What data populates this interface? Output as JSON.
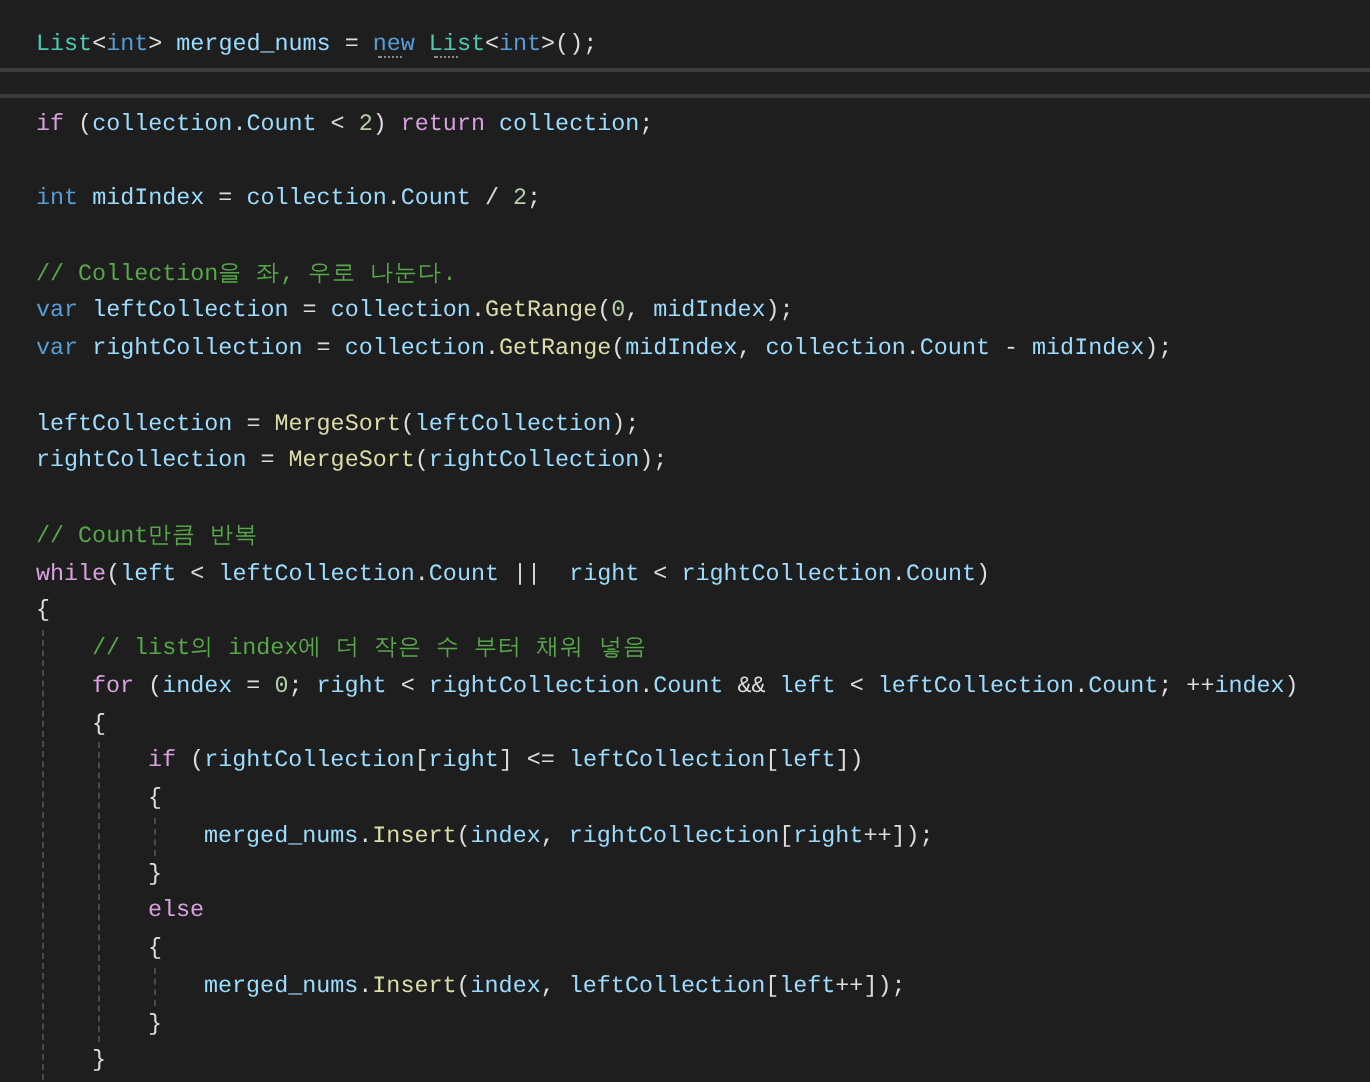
{
  "editor": {
    "lines": [
      {
        "kind": "code",
        "tokens": [
          {
            "kind": "type",
            "text": "List"
          },
          {
            "kind": "punct",
            "text": "<"
          },
          {
            "kind": "kw",
            "text": "int"
          },
          {
            "kind": "punct",
            "text": "> "
          },
          {
            "kind": "var",
            "text": "merged_nums"
          },
          {
            "kind": "punct",
            "text": " = "
          },
          {
            "kind": "kw",
            "text": "new ",
            "hint": true
          },
          {
            "kind": "type",
            "text": "List",
            "hint": true
          },
          {
            "kind": "punct",
            "text": "<"
          },
          {
            "kind": "kw",
            "text": "int"
          },
          {
            "kind": "punct",
            "text": ">();"
          }
        ]
      },
      {
        "kind": "cursor-line"
      },
      {
        "kind": "code",
        "tokens": [
          {
            "kind": "ctrl",
            "text": "if"
          },
          {
            "kind": "punct",
            "text": " ("
          },
          {
            "kind": "var",
            "text": "collection"
          },
          {
            "kind": "punct",
            "text": "."
          },
          {
            "kind": "var",
            "text": "Count"
          },
          {
            "kind": "punct",
            "text": " < "
          },
          {
            "kind": "num",
            "text": "2"
          },
          {
            "kind": "punct",
            "text": ") "
          },
          {
            "kind": "ctrl",
            "text": "return "
          },
          {
            "kind": "var",
            "text": "collection"
          },
          {
            "kind": "punct",
            "text": ";"
          }
        ]
      },
      {
        "kind": "blank"
      },
      {
        "kind": "code",
        "tokens": [
          {
            "kind": "kw",
            "text": "int "
          },
          {
            "kind": "var",
            "text": "midIndex"
          },
          {
            "kind": "punct",
            "text": " = "
          },
          {
            "kind": "var",
            "text": "collection"
          },
          {
            "kind": "punct",
            "text": "."
          },
          {
            "kind": "var",
            "text": "Count"
          },
          {
            "kind": "punct",
            "text": " / "
          },
          {
            "kind": "num",
            "text": "2"
          },
          {
            "kind": "punct",
            "text": ";"
          }
        ]
      },
      {
        "kind": "blank"
      },
      {
        "kind": "code",
        "tokens": [
          {
            "kind": "cmt",
            "text": "// Collection을 좌, 우로 나눈다."
          }
        ]
      },
      {
        "kind": "code",
        "tokens": [
          {
            "kind": "kw",
            "text": "var "
          },
          {
            "kind": "var",
            "text": "leftCollection"
          },
          {
            "kind": "punct",
            "text": " = "
          },
          {
            "kind": "var",
            "text": "collection"
          },
          {
            "kind": "punct",
            "text": "."
          },
          {
            "kind": "fn",
            "text": "GetRange"
          },
          {
            "kind": "punct",
            "text": "("
          },
          {
            "kind": "num",
            "text": "0"
          },
          {
            "kind": "punct",
            "text": ", "
          },
          {
            "kind": "var",
            "text": "midIndex"
          },
          {
            "kind": "punct",
            "text": ");"
          }
        ]
      },
      {
        "kind": "code",
        "tokens": [
          {
            "kind": "kw",
            "text": "var "
          },
          {
            "kind": "var",
            "text": "rightCollection"
          },
          {
            "kind": "punct",
            "text": " = "
          },
          {
            "kind": "var",
            "text": "collection"
          },
          {
            "kind": "punct",
            "text": "."
          },
          {
            "kind": "fn",
            "text": "GetRange"
          },
          {
            "kind": "punct",
            "text": "("
          },
          {
            "kind": "var",
            "text": "midIndex"
          },
          {
            "kind": "punct",
            "text": ", "
          },
          {
            "kind": "var",
            "text": "collection"
          },
          {
            "kind": "punct",
            "text": "."
          },
          {
            "kind": "var",
            "text": "Count"
          },
          {
            "kind": "punct",
            "text": " - "
          },
          {
            "kind": "var",
            "text": "midIndex"
          },
          {
            "kind": "punct",
            "text": ");"
          }
        ]
      },
      {
        "kind": "blank"
      },
      {
        "kind": "code",
        "tokens": [
          {
            "kind": "var",
            "text": "leftCollection"
          },
          {
            "kind": "punct",
            "text": " = "
          },
          {
            "kind": "fn",
            "text": "MergeSort"
          },
          {
            "kind": "punct",
            "text": "("
          },
          {
            "kind": "var",
            "text": "leftCollection"
          },
          {
            "kind": "punct",
            "text": ");"
          }
        ]
      },
      {
        "kind": "code",
        "tokens": [
          {
            "kind": "var",
            "text": "rightCollection"
          },
          {
            "kind": "punct",
            "text": " = "
          },
          {
            "kind": "fn",
            "text": "MergeSort"
          },
          {
            "kind": "punct",
            "text": "("
          },
          {
            "kind": "var",
            "text": "rightCollection"
          },
          {
            "kind": "punct",
            "text": ");"
          }
        ]
      },
      {
        "kind": "blank"
      },
      {
        "kind": "code",
        "tokens": [
          {
            "kind": "cmt",
            "text": "// Count만큼 반복"
          }
        ]
      },
      {
        "kind": "code",
        "tokens": [
          {
            "kind": "ctrl",
            "text": "while"
          },
          {
            "kind": "punct",
            "text": "("
          },
          {
            "kind": "var",
            "text": "left"
          },
          {
            "kind": "punct",
            "text": " < "
          },
          {
            "kind": "var",
            "text": "leftCollection"
          },
          {
            "kind": "punct",
            "text": "."
          },
          {
            "kind": "var",
            "text": "Count"
          },
          {
            "kind": "punct",
            "text": " ||  "
          },
          {
            "kind": "var",
            "text": "right"
          },
          {
            "kind": "punct",
            "text": " < "
          },
          {
            "kind": "var",
            "text": "rightCollection"
          },
          {
            "kind": "punct",
            "text": "."
          },
          {
            "kind": "var",
            "text": "Count"
          },
          {
            "kind": "punct",
            "text": ")"
          }
        ]
      },
      {
        "kind": "code",
        "tokens": [
          {
            "kind": "punct",
            "text": "{"
          }
        ],
        "children": [
          {
            "kind": "code",
            "tokens": [
              {
                "kind": "cmt",
                "text": "// list의 index에 더 작은 수 부터 채워 넣음"
              }
            ]
          },
          {
            "kind": "code",
            "tokens": [
              {
                "kind": "ctrl",
                "text": "for"
              },
              {
                "kind": "punct",
                "text": " ("
              },
              {
                "kind": "var",
                "text": "index"
              },
              {
                "kind": "punct",
                "text": " = "
              },
              {
                "kind": "num",
                "text": "0"
              },
              {
                "kind": "punct",
                "text": "; "
              },
              {
                "kind": "var",
                "text": "right"
              },
              {
                "kind": "punct",
                "text": " < "
              },
              {
                "kind": "var",
                "text": "rightCollection"
              },
              {
                "kind": "punct",
                "text": "."
              },
              {
                "kind": "var",
                "text": "Count"
              },
              {
                "kind": "punct",
                "text": " && "
              },
              {
                "kind": "var",
                "text": "left"
              },
              {
                "kind": "punct",
                "text": " < "
              },
              {
                "kind": "var",
                "text": "leftCollection"
              },
              {
                "kind": "punct",
                "text": "."
              },
              {
                "kind": "var",
                "text": "Count"
              },
              {
                "kind": "punct",
                "text": "; ++"
              },
              {
                "kind": "var",
                "text": "index"
              },
              {
                "kind": "punct",
                "text": ")"
              }
            ]
          },
          {
            "kind": "code",
            "tokens": [
              {
                "kind": "punct",
                "text": "{"
              }
            ],
            "children": [
              {
                "kind": "code",
                "tokens": [
                  {
                    "kind": "ctrl",
                    "text": "if"
                  },
                  {
                    "kind": "punct",
                    "text": " ("
                  },
                  {
                    "kind": "var",
                    "text": "rightCollection"
                  },
                  {
                    "kind": "punct",
                    "text": "["
                  },
                  {
                    "kind": "var",
                    "text": "right"
                  },
                  {
                    "kind": "punct",
                    "text": "] <= "
                  },
                  {
                    "kind": "var",
                    "text": "leftCollection"
                  },
                  {
                    "kind": "punct",
                    "text": "["
                  },
                  {
                    "kind": "var",
                    "text": "left"
                  },
                  {
                    "kind": "punct",
                    "text": "])"
                  }
                ]
              },
              {
                "kind": "code",
                "tokens": [
                  {
                    "kind": "punct",
                    "text": "{"
                  }
                ],
                "children": [
                  {
                    "kind": "code",
                    "tokens": [
                      {
                        "kind": "var",
                        "text": "merged_nums"
                      },
                      {
                        "kind": "punct",
                        "text": "."
                      },
                      {
                        "kind": "fn",
                        "text": "Insert"
                      },
                      {
                        "kind": "punct",
                        "text": "("
                      },
                      {
                        "kind": "var",
                        "text": "index"
                      },
                      {
                        "kind": "punct",
                        "text": ", "
                      },
                      {
                        "kind": "var",
                        "text": "rightCollection"
                      },
                      {
                        "kind": "punct",
                        "text": "["
                      },
                      {
                        "kind": "var",
                        "text": "right"
                      },
                      {
                        "kind": "punct",
                        "text": "++]);"
                      }
                    ]
                  }
                ]
              },
              {
                "kind": "code",
                "tokens": [
                  {
                    "kind": "punct",
                    "text": "}"
                  }
                ]
              },
              {
                "kind": "code",
                "tokens": [
                  {
                    "kind": "ctrl",
                    "text": "else"
                  }
                ]
              },
              {
                "kind": "code",
                "tokens": [
                  {
                    "kind": "punct",
                    "text": "{"
                  }
                ],
                "children": [
                  {
                    "kind": "code",
                    "tokens": [
                      {
                        "kind": "var",
                        "text": "merged_nums"
                      },
                      {
                        "kind": "punct",
                        "text": "."
                      },
                      {
                        "kind": "fn",
                        "text": "Insert"
                      },
                      {
                        "kind": "punct",
                        "text": "("
                      },
                      {
                        "kind": "var",
                        "text": "index"
                      },
                      {
                        "kind": "punct",
                        "text": ", "
                      },
                      {
                        "kind": "var",
                        "text": "leftCollection"
                      },
                      {
                        "kind": "punct",
                        "text": "["
                      },
                      {
                        "kind": "var",
                        "text": "left"
                      },
                      {
                        "kind": "punct",
                        "text": "++]);"
                      }
                    ]
                  }
                ]
              },
              {
                "kind": "code",
                "tokens": [
                  {
                    "kind": "punct",
                    "text": "}"
                  }
                ]
              }
            ]
          },
          {
            "kind": "code",
            "tokens": [
              {
                "kind": "punct",
                "text": "}"
              }
            ]
          }
        ]
      }
    ]
  }
}
